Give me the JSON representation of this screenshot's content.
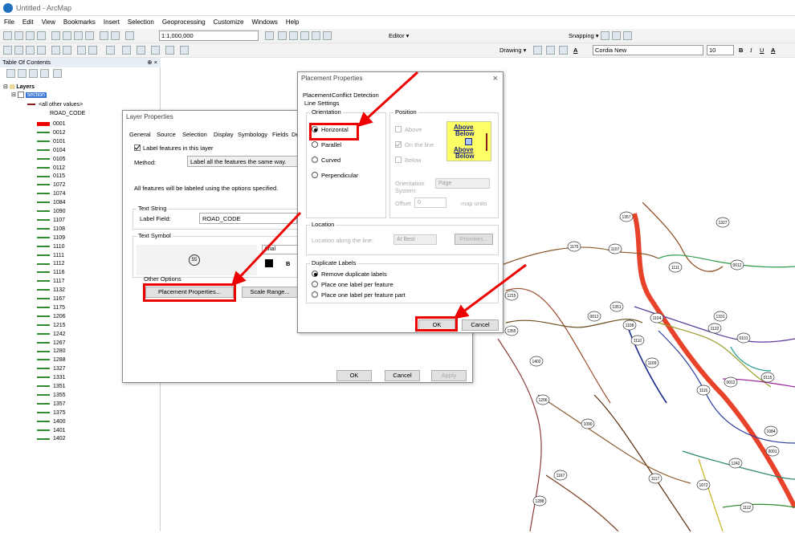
{
  "window": {
    "title": "Untitled - ArcMap"
  },
  "menu": [
    "File",
    "Edit",
    "View",
    "Bookmarks",
    "Insert",
    "Selection",
    "Geoprocessing",
    "Customize",
    "Windows",
    "Help"
  ],
  "toolbar": {
    "scale": "1:1,000,000",
    "editor_label": "Editor ▾",
    "snapping_label": "Snapping ▾",
    "drawing_label": "Drawing ▾",
    "font_name": "Cordia New",
    "font_size": "10",
    "bold": "B",
    "italic": "I",
    "underline": "U",
    "fontcolor": "A"
  },
  "toc": {
    "title": "Table Of Contents",
    "pin": "⊕ ×",
    "layers_label": "Layers",
    "layer_name": "section",
    "all_other": "<all other values>",
    "field": "ROAD_CODE",
    "codes": [
      "0001",
      "0012",
      "0101",
      "0104",
      "0105",
      "0112",
      "0115",
      "1072",
      "1074",
      "1084",
      "1090",
      "1107",
      "1108",
      "1109",
      "1110",
      "1111",
      "1112",
      "1116",
      "1117",
      "1132",
      "1167",
      "1175",
      "1206",
      "1215",
      "1242",
      "1267",
      "1280",
      "1288",
      "1327",
      "1331",
      "1351",
      "1355",
      "1357",
      "1375",
      "1400",
      "1401",
      "1402"
    ]
  },
  "layer_props": {
    "title": "Layer Properties",
    "tabs": [
      "General",
      "Source",
      "Selection",
      "Display",
      "Symbology",
      "Fields",
      "De"
    ],
    "label_features": "Label features in this layer",
    "method_label": "Method:",
    "method_value": "Label all the features the same way.",
    "all_features_note": "All features will be labeled using the options specified.",
    "text_string_group": "Text String",
    "label_field_label": "Label Field:",
    "label_field_value": "ROAD_CODE",
    "text_symbol_group": "Text Symbol",
    "preview_text": "55",
    "font_value": "Arial",
    "bold": "B",
    "other_options_group": "Other Options",
    "placement_btn": "Placement Properties...",
    "scale_btn": "Scale Range...",
    "ok": "OK",
    "cancel": "Cancel",
    "apply": "Apply"
  },
  "placement": {
    "title": "Placement Properties",
    "close": "×",
    "tabs": [
      "Placement",
      "Conflict Detection"
    ],
    "line_settings": "Line Settings",
    "orientation_group": "Orientation",
    "options": [
      "Horizontal",
      "Parallel",
      "Curved",
      "Perpendicular"
    ],
    "position_group": "Position",
    "above": "Above",
    "on_line": "On the line",
    "below": "Below",
    "preview_above": "Above",
    "preview_below": "Below",
    "orient_sys_label": "Orientation System:",
    "orient_sys_value": "Page",
    "offset_label": "Offset",
    "offset_value": "0",
    "offset_unit": "map units",
    "location_group": "Location",
    "location_label": "Location along the line:",
    "location_value": "At Best",
    "priorities_btn": "Priorities...",
    "dup_group": "Duplicate Labels",
    "dup_options": [
      "Remove duplicate labels",
      "Place one label per feature",
      "Place one label per feature part"
    ],
    "ok": "OK",
    "cancel": "Cancel"
  },
  "map_labels": [
    "1357",
    "1327",
    "1175",
    "1107",
    "1111",
    "0012",
    "1215",
    "1351",
    "0012",
    "1104",
    "1331",
    "1108",
    "1132",
    "1355",
    "1110",
    "0101",
    "1402",
    "1109",
    "0115",
    "1116",
    "0012",
    "1206",
    "1090",
    "1084",
    "0001",
    "1242",
    "1167",
    "1117",
    "1072",
    "1288",
    "1112"
  ],
  "colors": {
    "accent_red": "#e00000",
    "road_main": "#e8432a"
  }
}
